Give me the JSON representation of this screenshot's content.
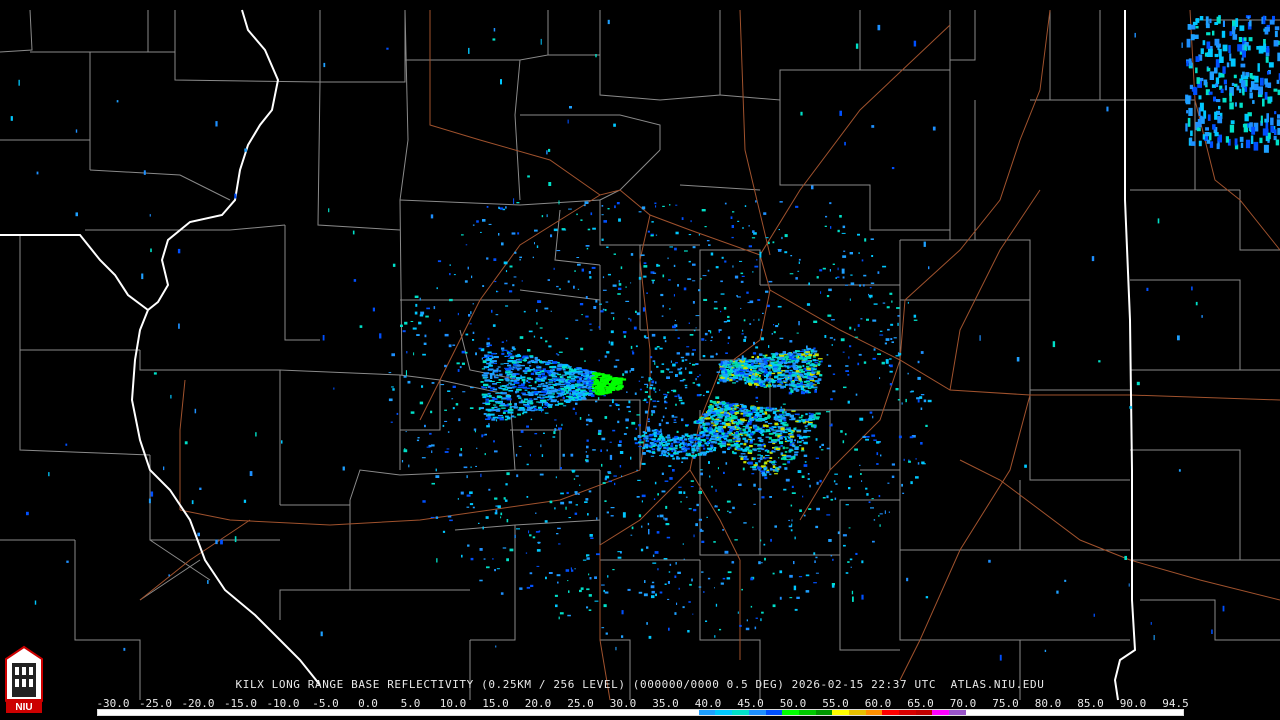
{
  "map": {
    "radar_site": "KILX",
    "product": "LONG RANGE BASE REFLECTIVITY",
    "resolution": "0.25KM / 256 LEVEL",
    "elevation": "(000000/0000 0.5 DEG)",
    "timestamp": "2026-02-15 22:37 UTC",
    "source": "ATLAS.NIU.EDU",
    "caption": "KILX LONG RANGE BASE REFLECTIVITY (0.25KM / 256 LEVEL) (000000/0000 0.5 DEG) 2026-02-15 22:37 UTC  ATLAS.NIU.EDU",
    "logo_text": "NIU",
    "colors": {
      "background": "#000000",
      "county_lines": "#8a8a8a",
      "state_lines": "#ffffff",
      "highways": "#a0522d"
    }
  },
  "scale": {
    "labels": [
      "-30.0",
      "-25.0",
      "-20.0",
      "-15.0",
      "-10.0",
      "-5.0",
      "0.0",
      "5.0",
      "10.0",
      "15.0",
      "20.0",
      "25.0",
      "30.0",
      "35.0",
      "40.0",
      "45.0",
      "50.0",
      "55.0",
      "60.0",
      "65.0",
      "70.0",
      "75.0",
      "80.0",
      "85.0",
      "90.0",
      "94.5"
    ],
    "colors": [
      "#ffffff",
      "#ffffff",
      "#ffffff",
      "#ffffff",
      "#ffffff",
      "#ffffff",
      "#ffffff",
      "#ffffff",
      "#ffffff",
      "#ffffff",
      "#ffffff",
      "#ffffff",
      "#ffffff",
      "#ffffff",
      "#ffffff",
      "#ffffff",
      "#ffffff",
      "#ffffff",
      "#ffffff",
      "#ffffff",
      "#ffffff",
      "#ffffff",
      "#ffffff",
      "#ffffff",
      "#ffffff",
      "#ffffff",
      "#ffffff",
      "#ffffff",
      "#ffffff",
      "#ffffff",
      "#ffffff",
      "#ffffff",
      "#ffffff",
      "#ffffff",
      "#ffffff",
      "#ffffff",
      "#1ea0ff",
      "#00c8ff",
      "#00e0c8",
      "#1e90ff",
      "#0050ff",
      "#00ff00",
      "#00c800",
      "#009600",
      "#ffff00",
      "#e6c000",
      "#ff9000",
      "#ff0000",
      "#d60000",
      "#c00000",
      "#ff00ff",
      "#9955c9",
      "#ffffff",
      "#ffffff",
      "#ffffff",
      "#ffffff",
      "#ffffff",
      "#ffffff",
      "#ffffff",
      "#ffffff",
      "#ffffff",
      "#ffffff",
      "#ffffff",
      "#ffffff",
      "#ffffff"
    ]
  }
}
